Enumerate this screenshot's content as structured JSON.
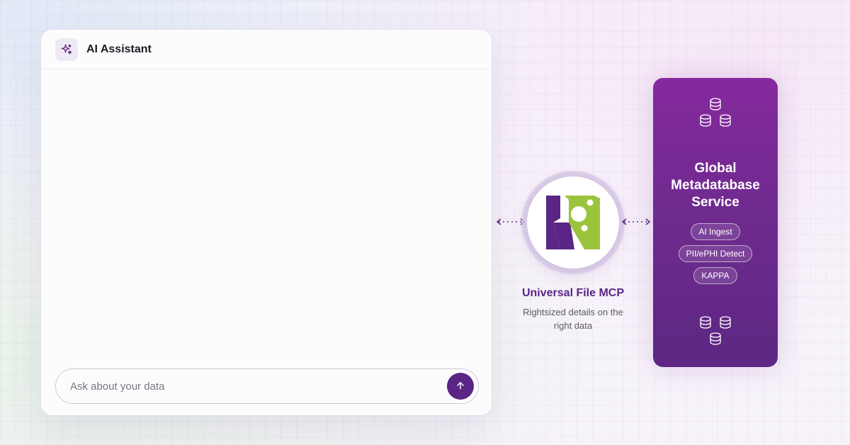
{
  "chat": {
    "title": "AI Assistant",
    "input_placeholder": "Ask about your data"
  },
  "mcp": {
    "title": "Universal File MCP",
    "subtitle": "Rightsized details on the right data"
  },
  "service": {
    "title_line1": "Global",
    "title_line2": "Metadatabase",
    "title_line3": "Service",
    "tags": [
      "AI Ingest",
      "PII/ePHI Detect",
      "KAPPA"
    ]
  },
  "colors": {
    "brand_purple": "#5a2585",
    "card_purple": "#7a2a97",
    "logo_green": "#9ac43c"
  },
  "icons": {
    "header": "sparkles-icon",
    "send": "arrow-up-icon",
    "database": "database-icon"
  }
}
